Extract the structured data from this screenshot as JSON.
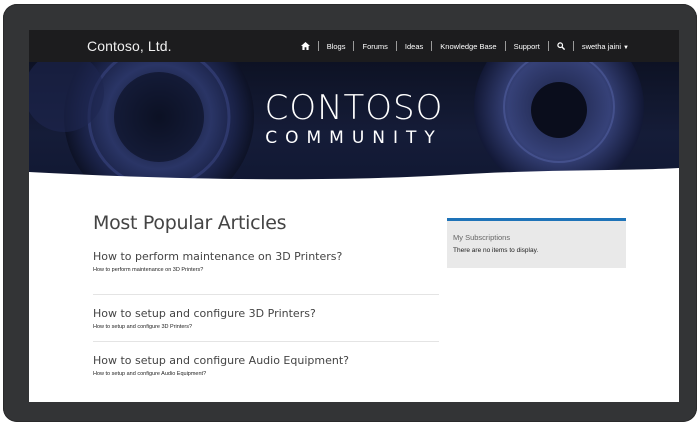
{
  "site": {
    "brand": "Contoso, Ltd."
  },
  "nav": {
    "items": [
      "Blogs",
      "Forums",
      "Ideas",
      "Knowledge Base",
      "Support"
    ],
    "user": "swetha jaini"
  },
  "hero": {
    "title": "CONTOSO",
    "subtitle": "COMMUNITY"
  },
  "main": {
    "heading": "Most Popular Articles",
    "articles": [
      {
        "title": "How to perform maintenance on 3D Printers?",
        "desc": "How to perform maintenance on 3D Printers?"
      },
      {
        "title": "How to setup and configure 3D Printers?",
        "desc": "How to setup and configure 3D Printers?"
      },
      {
        "title": "How to setup and configure Audio Equipment?",
        "desc": "How to setup and configure Audio Equipment?"
      }
    ]
  },
  "sidebar": {
    "title": "My Subscriptions",
    "empty": "There are no items to display.",
    "accent": "#1e73b8"
  }
}
